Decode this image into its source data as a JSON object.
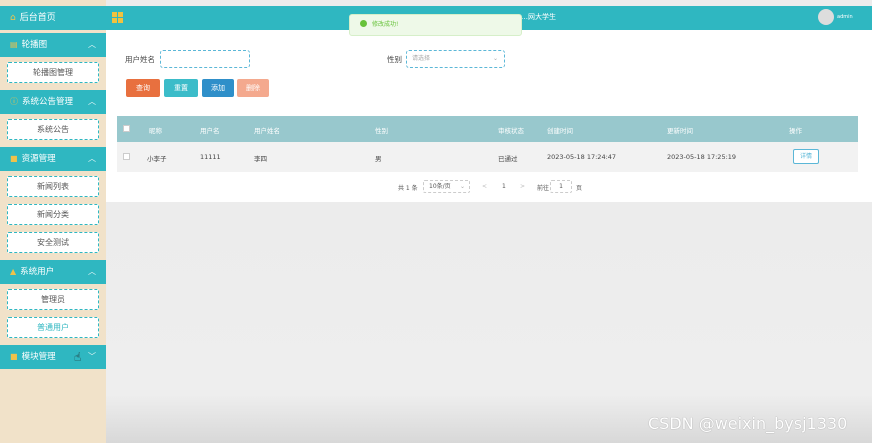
{
  "sidebar": {
    "home": "后台首页",
    "groups": [
      {
        "label": "轮播图",
        "items": [
          "轮播图管理"
        ]
      },
      {
        "label": "系统公告管理",
        "items": [
          "系统公告"
        ]
      },
      {
        "label": "资源管理",
        "items": [
          "新闻列表",
          "新闻分类",
          "安全测试"
        ]
      },
      {
        "label": "系统用户",
        "items": [
          "管理员",
          "普通用户"
        ]
      },
      {
        "label": "模块管理",
        "items": []
      }
    ],
    "active_item": "普通用户"
  },
  "header": {
    "title": "…网大学生",
    "user": "admin"
  },
  "toast": {
    "message": "修改成功!"
  },
  "search": {
    "username_label": "用户姓名",
    "username_placeholder": "",
    "gender_label": "性别",
    "gender_placeholder": "请选择"
  },
  "buttons": {
    "query": "查询",
    "reset": "重置",
    "add": "添加",
    "delete": "删除"
  },
  "colors": {
    "teal": "#2fb7c1",
    "query": "#e8703f",
    "reset": "#3bbcc9",
    "add": "#2f8fc9",
    "delete": "#f4a98e"
  },
  "table": {
    "columns": [
      "昵称",
      "用户名",
      "用户姓名",
      "性别",
      "审核状态",
      "创建时间",
      "更新时间",
      "操作"
    ],
    "rows": [
      {
        "nickname": "小李子",
        "username": "11111",
        "realname": "李四",
        "gender": "男",
        "status": "已通过",
        "created": "2023-05-18 17:24:47",
        "updated": "2023-05-18 17:25:19",
        "action": "详情"
      }
    ]
  },
  "pagination": {
    "total": "共 1 条",
    "page_size": "10条/页",
    "prev": "<",
    "page": "1",
    "next": ">",
    "goto_label": "前往",
    "goto_value": "1",
    "goto_suffix": "页"
  },
  "watermark": "CSDN @weixin_bysj1330"
}
